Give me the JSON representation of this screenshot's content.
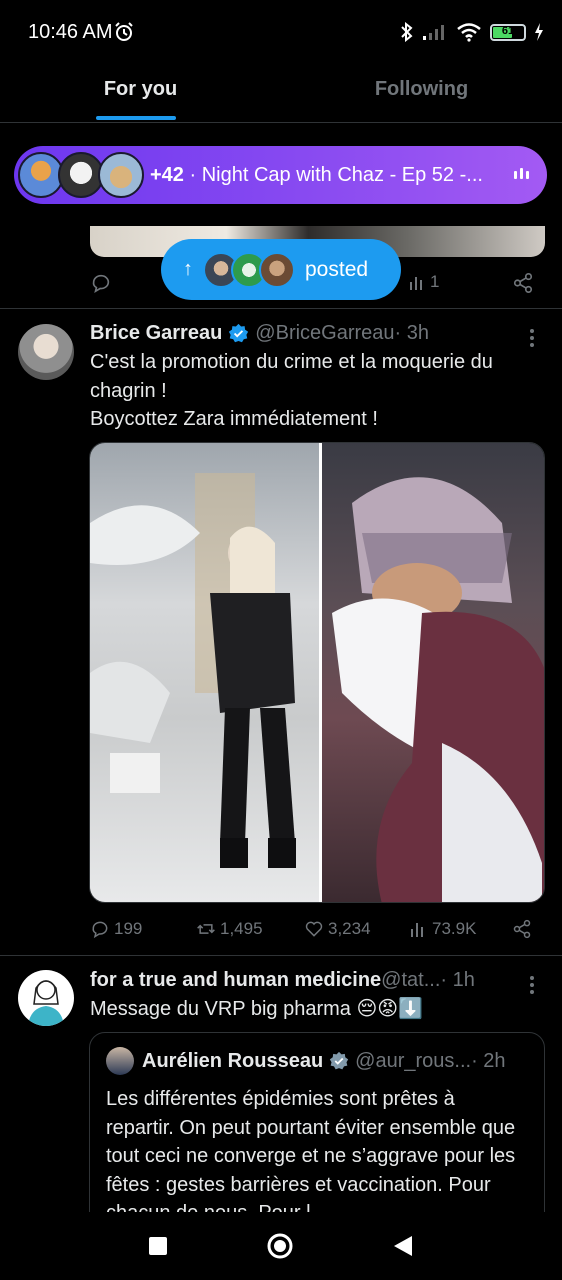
{
  "status_bar": {
    "time": "10:46 AM",
    "battery_level": "61",
    "icons": [
      "alarm-icon",
      "bluetooth-icon",
      "signal-icon",
      "wifi-icon",
      "battery-icon",
      "charging-icon"
    ]
  },
  "tabs": [
    {
      "label": "For you",
      "active": true
    },
    {
      "label": "Following",
      "active": false
    }
  ],
  "spaces_banner": {
    "count": "+42",
    "title": " · Night Cap with Chaz - Ep 52 -..."
  },
  "prev_tweet": {
    "views": "1"
  },
  "posted_pill": {
    "label": "posted"
  },
  "tweet1": {
    "name": "Brice Garreau",
    "handle": "@BriceGarreau",
    "time": " · 3h",
    "text_line1": "C'est la promotion du crime et la moquerie du",
    "text_line2": "chagrin !",
    "text_line3": " Boycottez Zara immédiatement !",
    "replies": "199",
    "reposts": "1,495",
    "likes": "3,234",
    "views": "73.9K"
  },
  "tweet2": {
    "name": "for a true and human medicine",
    "handle": " @tat...",
    "time": " · 1h",
    "text": "Message du VRP big pharma 😔😡⬇️",
    "quote": {
      "name": "Aurélien Rousseau",
      "handle": "@aur_rous...",
      "time": " · 2h",
      "text": "Les différentes épidémies sont prêtes à repartir. On peut pourtant éviter ensemble que tout ceci ne converge et ne s’aggrave pour les fêtes : gestes barrières et vaccination. Pour chacun de nous. Pour l"
    }
  },
  "colors": {
    "accent": "#1d9bf0",
    "spaces_gradient_start": "#6d37f0",
    "spaces_gradient_end": "#a35af3",
    "muted_text": "#71767b",
    "divider": "#2f3336"
  }
}
